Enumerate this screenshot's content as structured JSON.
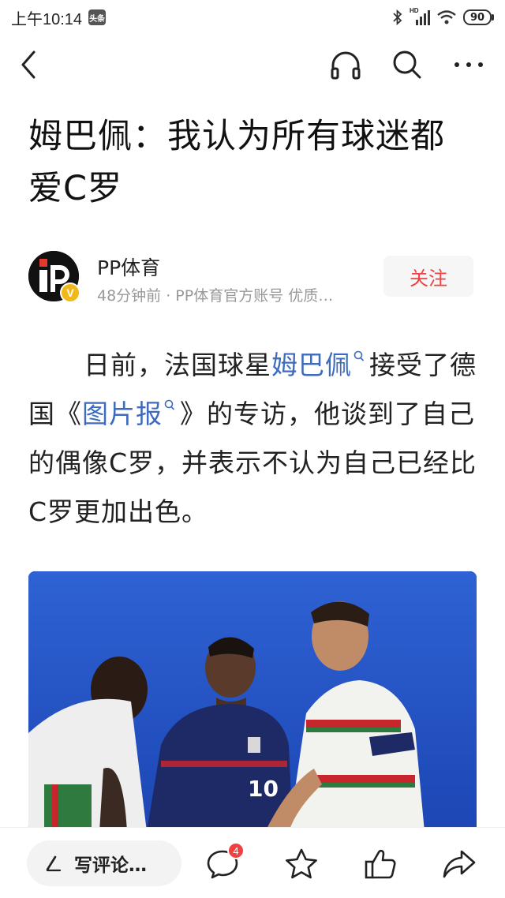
{
  "status_bar": {
    "time": "上午10:14",
    "app_badge": "头条",
    "network": "HD",
    "battery": "90"
  },
  "article": {
    "title": "姆巴佩：我认为所有球迷都爱C罗",
    "author": {
      "name": "PP体育",
      "meta": "48分钟前 · PP体育官方账号 优质…",
      "verified_mark": "V"
    },
    "follow_label": "关注",
    "body": {
      "p1_start": "日前，法国球星",
      "p1_link1": "姆巴佩",
      "p1_mid": "接受了德国《",
      "p1_link2": "图片报",
      "p1_end": "》的专访，他谈到了自己的偶像C罗，并表示不认为自己已经比C罗更加出色。"
    },
    "photo_jersey_number": "10"
  },
  "bottom_bar": {
    "comment_placeholder": "写评论…",
    "comment_count": "4"
  },
  "colors": {
    "accent_red": "#f04142",
    "link_blue": "#3e6bbd"
  },
  "icons": [
    "back-icon",
    "headphones-icon",
    "search-icon",
    "more-icon",
    "pen-icon",
    "comment-icon",
    "star-icon",
    "like-icon",
    "share-icon"
  ]
}
